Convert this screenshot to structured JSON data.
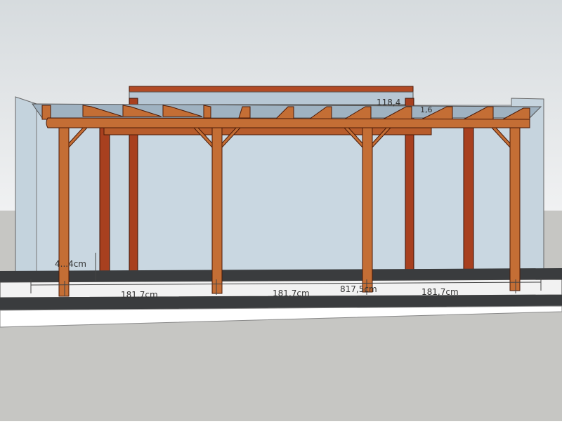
{
  "colors": {
    "sky_top": "#d8dde0",
    "sky_bottom": "#eef0f1",
    "ground": "#c6c6c3",
    "glass": "#c9d7e1",
    "wood": "#c46e35",
    "wood_dark": "#8f3c1a",
    "post_dark": "#a8401f",
    "slab": "#3b3d3f"
  },
  "dimensions": {
    "depth_top": "118,4",
    "depth_top_right": "1,6",
    "height": "4...4cm",
    "span_1": "181,7cm",
    "span_2": "181,7cm",
    "span_3": "181,7cm",
    "overall": "817,5cm"
  }
}
